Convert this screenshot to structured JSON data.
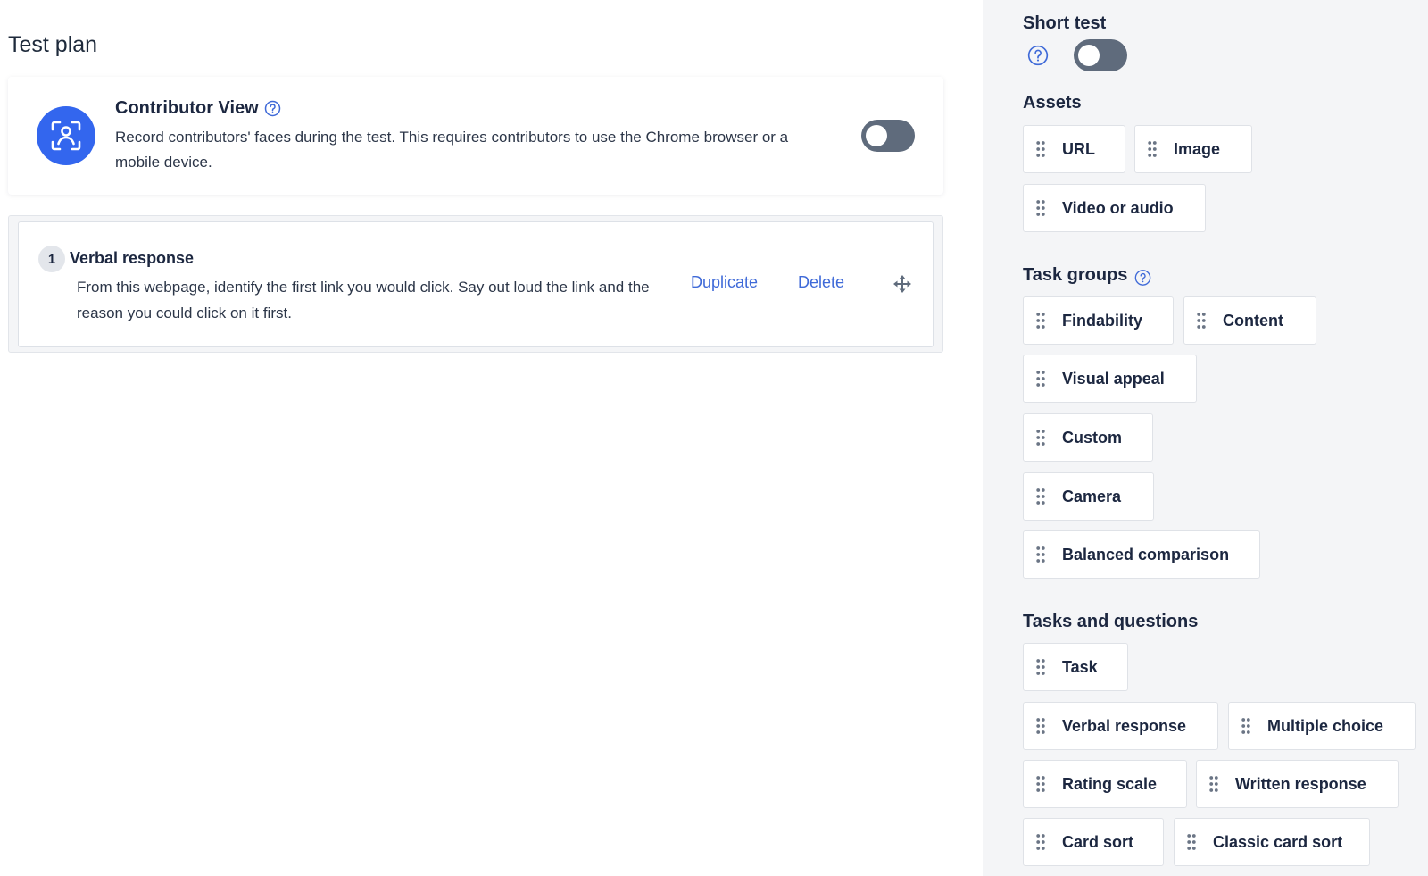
{
  "main": {
    "title": "Test plan",
    "contributor_view": {
      "title": "Contributor View",
      "description": "Record contributors' faces during the test. This requires contributors to use the Chrome browser or a mobile device.",
      "enabled": false
    },
    "tasks": [
      {
        "number": "1",
        "title": "Verbal response",
        "description": "From this webpage, identify the first link you would click. Say out loud the link and the reason you could click on it first.",
        "duplicate_label": "Duplicate",
        "delete_label": "Delete"
      }
    ]
  },
  "sidebar": {
    "short_test": {
      "title": "Short test",
      "enabled": false
    },
    "assets": {
      "title": "Assets",
      "items": [
        "URL",
        "Image",
        "Video or audio"
      ]
    },
    "task_groups": {
      "title": "Task groups",
      "items": [
        "Findability",
        "Content",
        "Visual appeal",
        "Custom",
        "Camera",
        "Balanced comparison"
      ]
    },
    "tasks_and_questions": {
      "title": "Tasks and questions",
      "items": [
        "Task",
        "Verbal response",
        "Multiple choice",
        "Rating scale",
        "Written response",
        "Card sort",
        "Classic card sort"
      ]
    }
  },
  "colors": {
    "accent": "#3366ee",
    "link": "#3f6ad8",
    "toggle_off": "#5f6b7c",
    "sidebar_bg": "#f4f5f7"
  },
  "icons": {
    "contributor_view": "face-scan-icon",
    "help": "question-circle-icon",
    "move": "move-arrows-icon",
    "grip": "drag-grip-icon"
  }
}
